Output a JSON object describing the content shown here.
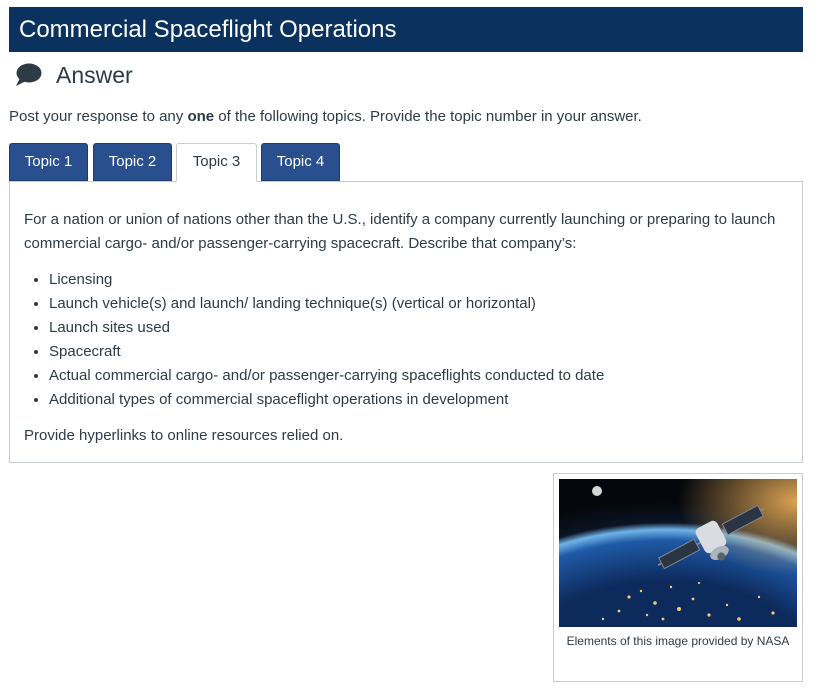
{
  "header": {
    "title": "Commercial Spaceflight Operations"
  },
  "answer": {
    "label": "Answer",
    "icon": "speech-bubble-icon"
  },
  "intro": {
    "before": "Post your response to any ",
    "bold": "one",
    "after": " of the following topics. Provide the topic number in your answer."
  },
  "tabs": [
    {
      "label": "Topic 1",
      "active": false
    },
    {
      "label": "Topic 2",
      "active": false
    },
    {
      "label": "Topic 3",
      "active": true
    },
    {
      "label": "Topic 4",
      "active": false
    }
  ],
  "panel": {
    "paragraph": "For a nation or union of nations other than the U.S., identify a company currently launching or preparing to launch commercial cargo- and/or passenger-carrying spacecraft. Describe that company’s:",
    "items": [
      "Licensing",
      "Launch vehicle(s) and launch/ landing technique(s) (vertical or horizontal)",
      "Launch sites used",
      "Spacecraft",
      "Actual commercial cargo- and/or passenger-carrying spaceflights conducted to date",
      "Additional types of commercial spaceflight operations in development"
    ],
    "footer": "Provide hyperlinks to online resources relied on."
  },
  "figure": {
    "caption": "Elements of this image provided by NASA"
  },
  "colors": {
    "banner": "#0b325e",
    "tab_inactive": "#2a4f8e",
    "text": "#2d3b45",
    "border": "#c7cdd1"
  }
}
